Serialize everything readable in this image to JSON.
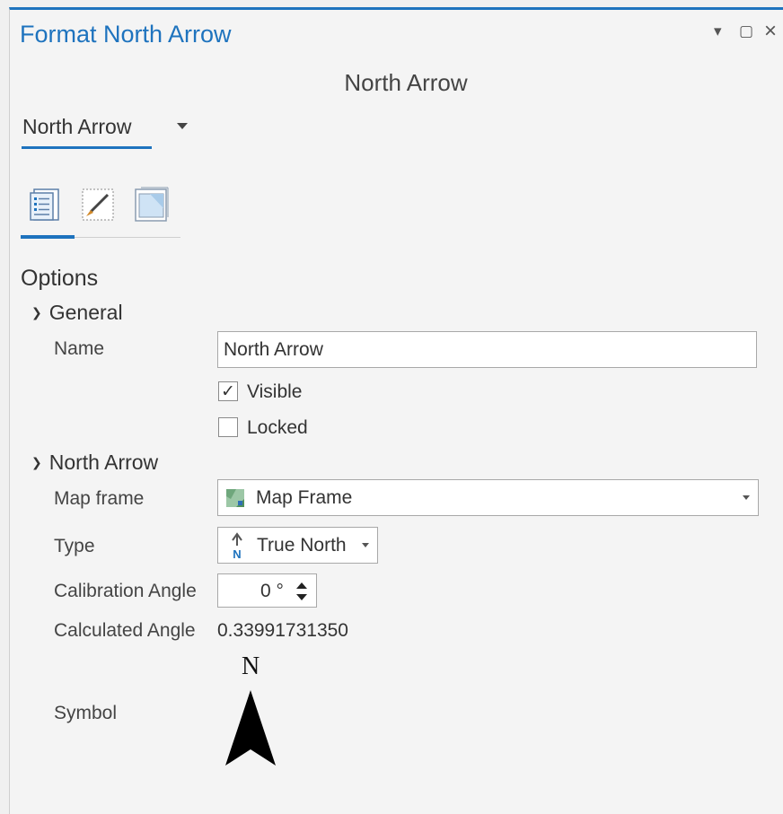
{
  "pane": {
    "title": "Format North Arrow",
    "controls": {
      "menu": "▾",
      "restore": "▢",
      "close": "×"
    }
  },
  "panel": {
    "heading": "North Arrow"
  },
  "element_selector": {
    "value": "North Arrow"
  },
  "tabs": [
    {
      "name": "options",
      "icon": "options-list-icon",
      "selected": true
    },
    {
      "name": "display",
      "icon": "brush-icon",
      "selected": false
    },
    {
      "name": "placement",
      "icon": "frame-icon",
      "selected": false
    }
  ],
  "options": {
    "title": "Options",
    "general": {
      "title": "General",
      "name_label": "Name",
      "name_value": "North Arrow",
      "visible_label": "Visible",
      "visible_checked": true,
      "locked_label": "Locked",
      "locked_checked": false
    },
    "north_arrow": {
      "title": "North Arrow",
      "map_frame_label": "Map frame",
      "map_frame_value": "Map Frame",
      "type_label": "Type",
      "type_value": "True North",
      "type_icon_letter": "N",
      "calibration_label": "Calibration Angle",
      "calibration_value": "0 °",
      "calculated_label": "Calculated Angle",
      "calculated_value": "0.33991731350",
      "symbol_label": "Symbol",
      "symbol_letter": "N"
    }
  },
  "colors": {
    "accent": "#1e73be"
  }
}
